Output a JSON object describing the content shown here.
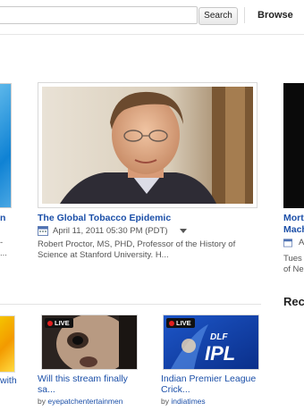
{
  "header": {
    "search_button": "Search",
    "browse_label": "Browse"
  },
  "featured": {
    "left_partial": {
      "title": "n",
      "desc_line1": "-",
      "desc_line2": "..."
    },
    "main": {
      "title": "The Global Tobacco Epidemic",
      "date": "April 11, 2011 05:30 PM (PDT)",
      "description": "Robert Proctor, MS, PHD, Professor of the History of Science at Stanford University. H..."
    },
    "right_partial": {
      "title_line1": "Mort",
      "title_line2": "Mach",
      "date": "A",
      "desc_line1": "Tues",
      "desc_line2": "of Ne"
    },
    "right_heading": "Rec"
  },
  "bottom": {
    "item1": {
      "title": "with"
    },
    "item2": {
      "live": "LIVE",
      "title_line1": "Will this stream finally",
      "title_line2": "sa...",
      "by": "by",
      "channel": "eyepatchentertainmen"
    },
    "item3": {
      "live": "LIVE",
      "title_line1": "Indian Premier League",
      "title_line2": "Crick...",
      "by": "by",
      "channel": "indiatimes",
      "logo_top": "DLF",
      "logo_main": "IPL"
    }
  },
  "icons": [
    "calendar-icon",
    "dropdown-caret-icon",
    "live-dot-icon"
  ],
  "colors": {
    "link": "#1b4fa8",
    "live_red": "#e21f1f"
  }
}
